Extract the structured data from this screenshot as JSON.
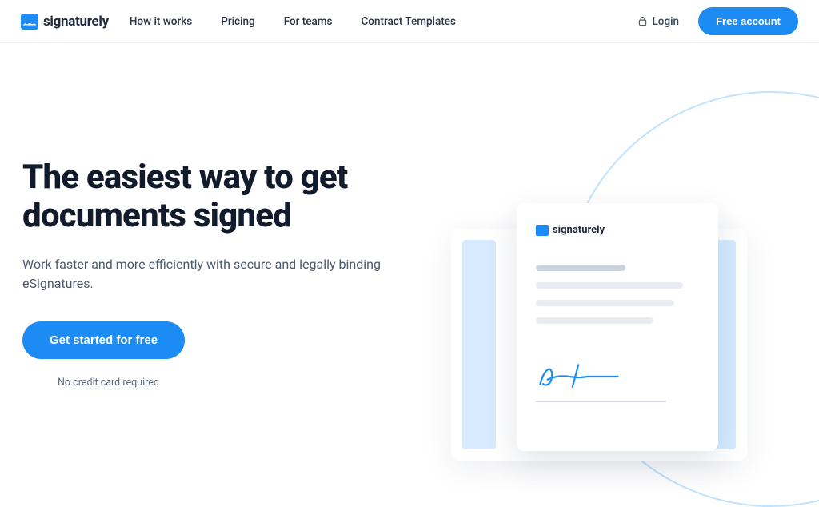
{
  "brand": "signaturely",
  "nav": {
    "links": [
      "How it works",
      "Pricing",
      "For teams",
      "Contract Templates"
    ],
    "login": "Login",
    "cta": "Free account"
  },
  "hero": {
    "title_line1": "The easiest way to get",
    "title_line2": "documents signed",
    "subtitle": "Work faster and more efficiently with secure and legally binding eSignatures.",
    "cta": "Get started for free",
    "note": "No credit card required"
  },
  "illustration": {
    "doc_brand": "signaturely"
  },
  "colors": {
    "primary": "#1c8cf4",
    "text_dark": "#1e2a3b",
    "text_muted": "#4a5a6e"
  }
}
